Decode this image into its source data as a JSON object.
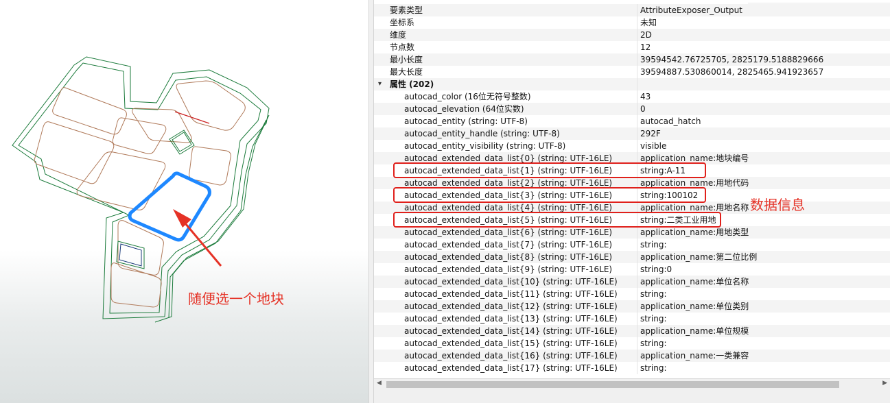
{
  "annotations": {
    "pick_parcel": "随便选一个地块",
    "data_info": "数据信息"
  },
  "colors": {
    "accent_red": "#e53226",
    "selection_blue": "#1e88ff",
    "road_green": "#1a7a3a",
    "parcel_brown": "#b07a5a"
  },
  "properties": {
    "general": [
      {
        "name": "要素类型",
        "value": "AttributeExposer_Output"
      },
      {
        "name": "坐标系",
        "value": "未知"
      },
      {
        "name": "维度",
        "value": "2D"
      },
      {
        "name": "节点数",
        "value": "12"
      },
      {
        "name": "最小长度",
        "value": "39594542.76725705, 2825179.5188829666"
      },
      {
        "name": "最大长度",
        "value": "39594887.530860014, 2825465.941923657"
      }
    ],
    "attributes_header": "属性 (202)",
    "attributes": [
      {
        "name": "autocad_color (16位无符号整数)",
        "value": "43"
      },
      {
        "name": "autocad_elevation (64位实数)",
        "value": "0"
      },
      {
        "name": "autocad_entity (string: UTF-8)",
        "value": "autocad_hatch"
      },
      {
        "name": "autocad_entity_handle (string: UTF-8)",
        "value": "292F"
      },
      {
        "name": "autocad_entity_visibility (string: UTF-8)",
        "value": "visible"
      },
      {
        "name": "autocad_extended_data_list{0} (string: UTF-16LE)",
        "value": "application_name:地块编号"
      },
      {
        "name": "autocad_extended_data_list{1} (string: UTF-16LE)",
        "value": "string:A-11"
      },
      {
        "name": "autocad_extended_data_list{2} (string: UTF-16LE)",
        "value": "application_name:用地代码"
      },
      {
        "name": "autocad_extended_data_list{3} (string: UTF-16LE)",
        "value": "string:100102"
      },
      {
        "name": "autocad_extended_data_list{4} (string: UTF-16LE)",
        "value": "application_name:用地名称"
      },
      {
        "name": "autocad_extended_data_list{5} (string: UTF-16LE)",
        "value": "string:二类工业用地"
      },
      {
        "name": "autocad_extended_data_list{6} (string: UTF-16LE)",
        "value": "application_name:用地类型"
      },
      {
        "name": "autocad_extended_data_list{7} (string: UTF-16LE)",
        "value": "string:"
      },
      {
        "name": "autocad_extended_data_list{8} (string: UTF-16LE)",
        "value": "application_name:第二位比例"
      },
      {
        "name": "autocad_extended_data_list{9} (string: UTF-16LE)",
        "value": "string:0"
      },
      {
        "name": "autocad_extended_data_list{10} (string: UTF-16LE)",
        "value": "application_name:单位名称"
      },
      {
        "name": "autocad_extended_data_list{11} (string: UTF-16LE)",
        "value": "string:"
      },
      {
        "name": "autocad_extended_data_list{12} (string: UTF-16LE)",
        "value": "application_name:单位类别"
      },
      {
        "name": "autocad_extended_data_list{13} (string: UTF-16LE)",
        "value": "string:"
      },
      {
        "name": "autocad_extended_data_list{14} (string: UTF-16LE)",
        "value": "application_name:单位规模"
      },
      {
        "name": "autocad_extended_data_list{15} (string: UTF-16LE)",
        "value": "string:"
      },
      {
        "name": "autocad_extended_data_list{16} (string: UTF-16LE)",
        "value": "application_name:一类兼容"
      },
      {
        "name": "autocad_extended_data_list{17} (string: UTF-16LE)",
        "value": "string:"
      }
    ]
  }
}
